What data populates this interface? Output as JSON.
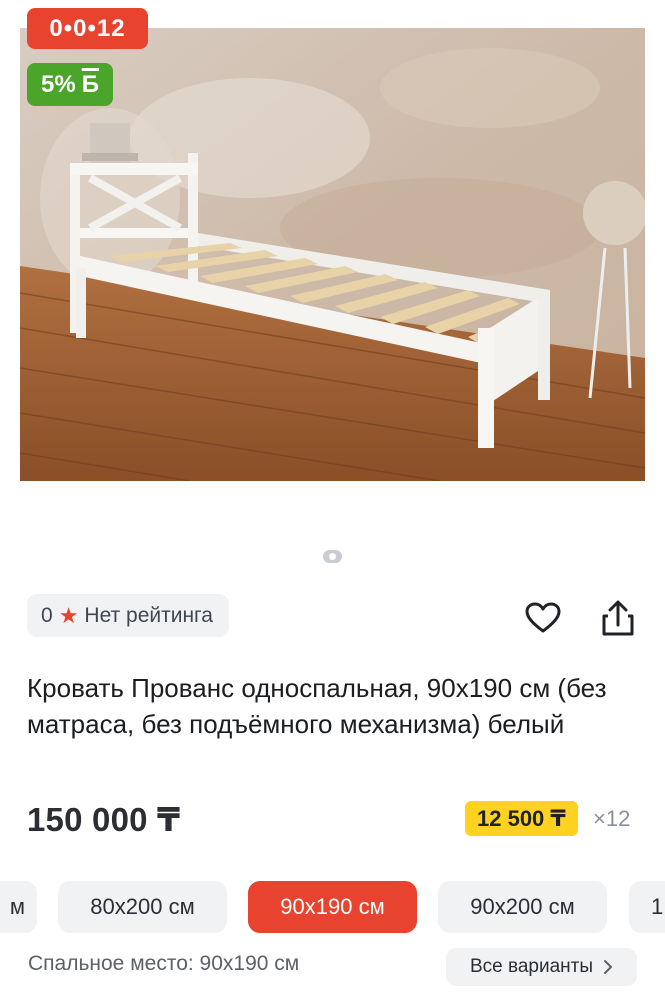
{
  "badges": {
    "timer": "0•0•12",
    "bonus_percent": "5%",
    "bonus_currency": "Б"
  },
  "product_image": {
    "alt_description_icon": "product-photo"
  },
  "rating": {
    "value": "0",
    "label": "Нет рейтинга",
    "star_icon": "star-icon"
  },
  "actions": {
    "favorite_icon": "heart-icon",
    "share_icon": "share-icon"
  },
  "product": {
    "title": "Кровать Прованс односпальная, 90х190 см (без матраса, без подъёмного механизма) белый",
    "price": "150 000 ₸",
    "installment_price": "12 500 ₸",
    "installment_count": "×12"
  },
  "variants": [
    {
      "label": "м",
      "active": false
    },
    {
      "label": "80х200 см",
      "active": false
    },
    {
      "label": "90х190 см",
      "active": true
    },
    {
      "label": "90х200 см",
      "active": false
    },
    {
      "label": "1",
      "active": false
    }
  ],
  "sleeping_place": {
    "label": "Спальное место: 90х190 см"
  },
  "all_variants": {
    "label": "Все варианты"
  },
  "colors": {
    "accent_red": "#e8432f",
    "bonus_green": "#4aa52a",
    "installment_yellow": "#ffd21f",
    "chip_gray": "#f1f2f4"
  }
}
